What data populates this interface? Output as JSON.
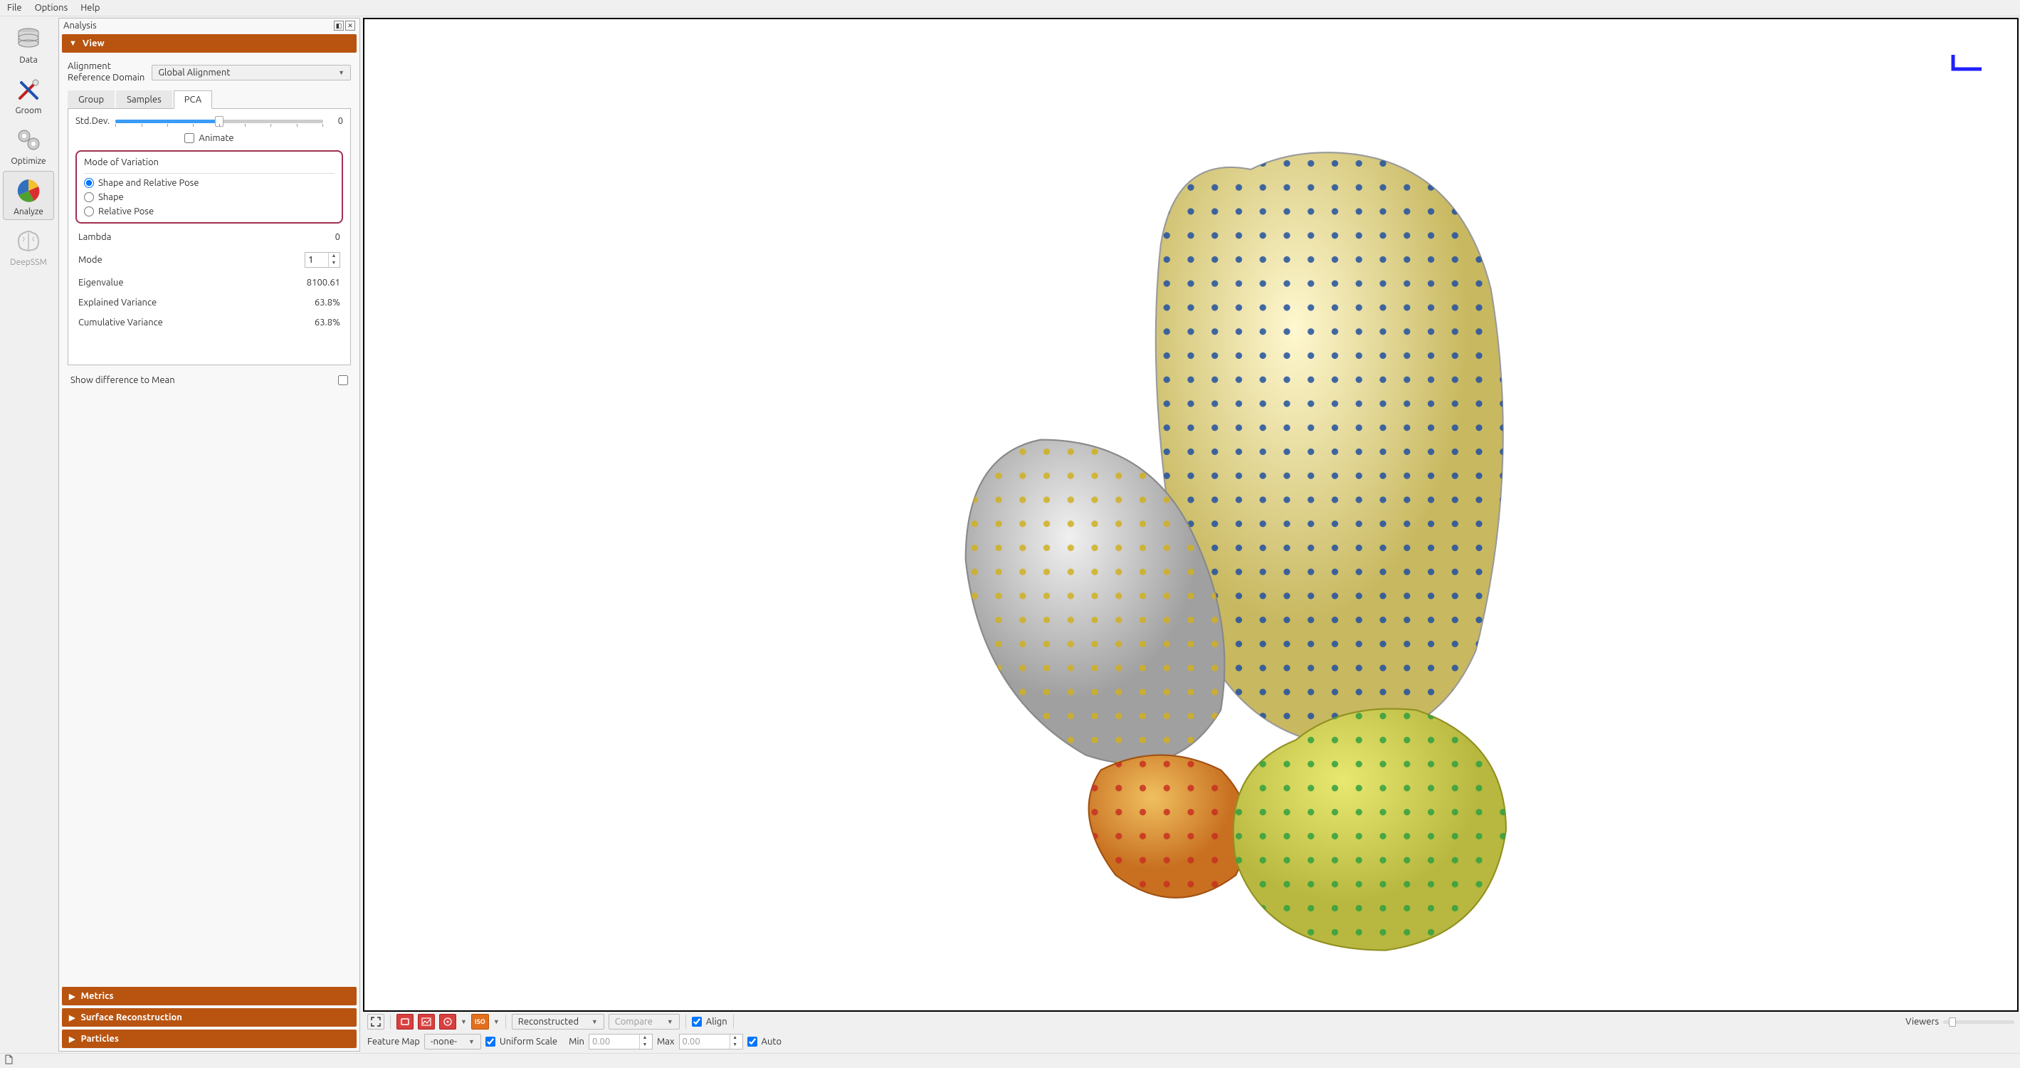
{
  "menubar": {
    "file": "File",
    "options": "Options",
    "help": "Help"
  },
  "toolbar": {
    "data": "Data",
    "groom": "Groom",
    "optimize": "Optimize",
    "analyze": "Analyze",
    "deepssm": "DeepSSM"
  },
  "panel": {
    "title": "Analysis",
    "sections": {
      "view": "View",
      "metrics": "Metrics",
      "surface": "Surface Reconstruction",
      "particles": "Particles"
    },
    "alignment_label_line1": "Alignment",
    "alignment_label_line2": "Reference Domain",
    "alignment_value": "Global Alignment",
    "tabs": {
      "group": "Group",
      "samples": "Samples",
      "pca": "PCA"
    },
    "stddev_label": "Std.Dev.",
    "stddev_value": "0",
    "animate_label": "Animate",
    "mode_box_title": "Mode of Variation",
    "mode_options": {
      "shape_pose": "Shape and Relative Pose",
      "shape": "Shape",
      "relative_pose": "Relative Pose"
    },
    "stats": {
      "lambda_label": "Lambda",
      "lambda_value": "0",
      "mode_label": "Mode",
      "mode_value": "1",
      "eigen_label": "Eigenvalue",
      "eigen_value": "8100.61",
      "exvar_label": "Explained Variance",
      "exvar_value": "63.8%",
      "cumvar_label": "Cumulative Variance",
      "cumvar_value": "63.8%"
    },
    "show_diff_label": "Show difference to Mean"
  },
  "viewer_bar": {
    "reconstructed": "Reconstructed",
    "compare": "Compare",
    "align": "Align",
    "viewers": "Viewers",
    "feature_map": "Feature Map",
    "feature_value": "-none-",
    "uniform_scale": "Uniform Scale",
    "min_label": "Min",
    "min_value": "0.00",
    "max_label": "Max",
    "max_value": "0.00",
    "auto": "Auto",
    "iso": "ISO"
  }
}
